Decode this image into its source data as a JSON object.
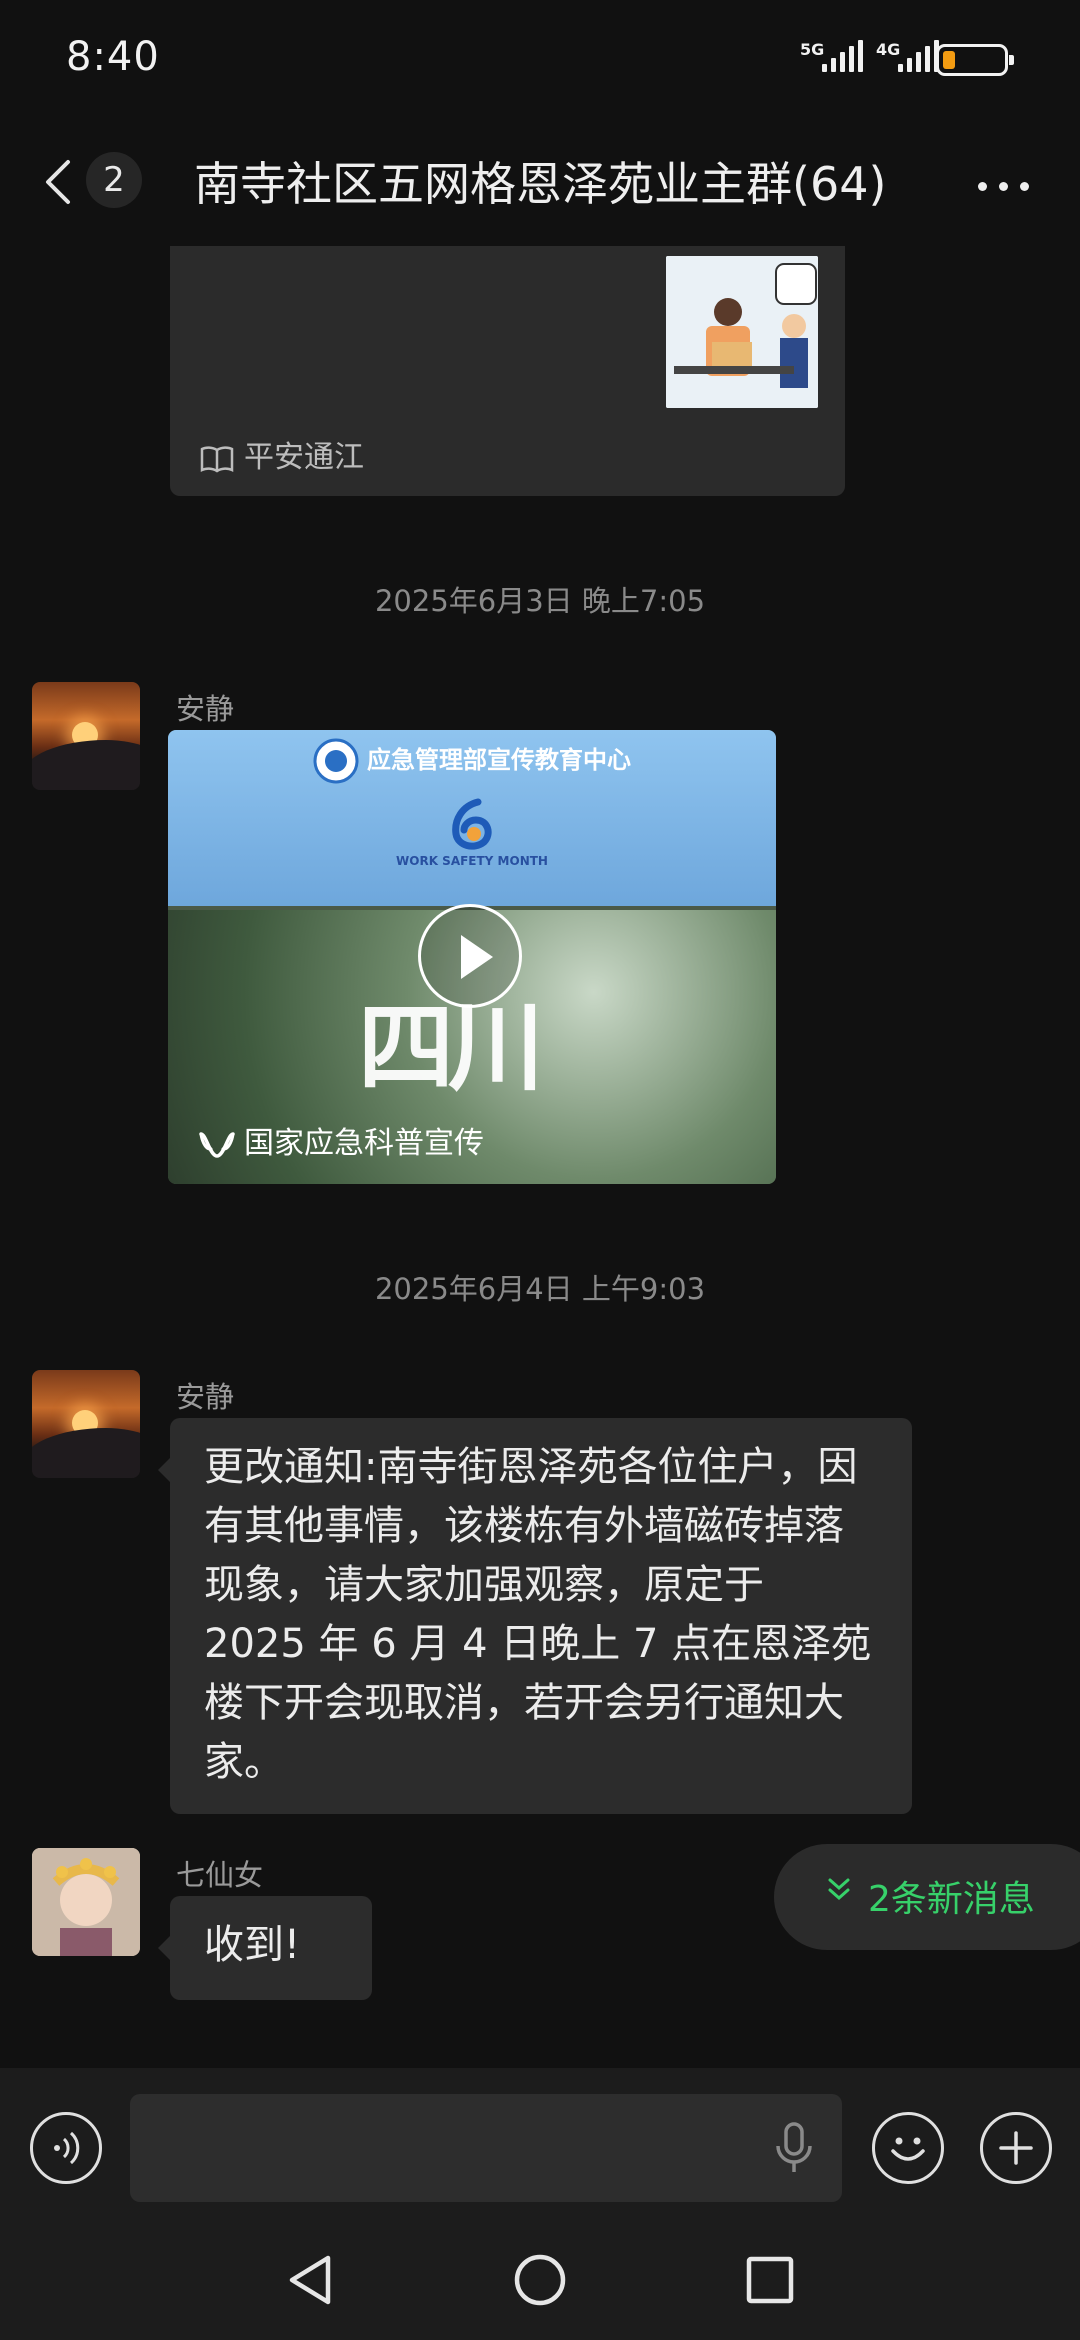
{
  "status_bar": {
    "time": "8:40",
    "network_1": "5G",
    "network_2": "4G",
    "battery_level": 0.2
  },
  "header": {
    "unread_count": "2",
    "title": "南寺社区五网格恩泽苑业主群(64)"
  },
  "messages": {
    "card_source": "平安通江",
    "timestamp_1": "2025年6月3日 晚上7:05",
    "sender_1": "安静",
    "video_header": "应急管理部宣传教育中心",
    "video_subheader": "WORK SAFETY MONTH",
    "video_calligraphy": "四川",
    "video_source": "国家应急科普宣传",
    "timestamp_2": "2025年6月4日 上午9:03",
    "sender_2": "安静",
    "text_2": "更改通知:南寺街恩泽苑各位住户，因有其他事情，该楼栋有外墙磁砖掉落现象，请大家加强观察，原定于 2025 年 6 月 4 日晚上 7 点在恩泽苑楼下开会现取消，若开会另行通知大家。",
    "sender_3": "七仙女",
    "text_3": "收到!"
  },
  "new_messages_label": "2条新消息",
  "colors": {
    "background": "#111111",
    "bubble": "#2c2c2c",
    "accent_green": "#37d16a",
    "battery_orange": "#f39c12"
  },
  "icons": {
    "back": "chevron-left-icon",
    "more": "more-dots-icon",
    "voice": "voice-icon",
    "mic": "mic-icon",
    "emoji": "emoji-icon",
    "add": "plus-icon",
    "nav_back": "triangle-back-icon",
    "nav_home": "circle-home-icon",
    "nav_recent": "square-recent-icon"
  }
}
